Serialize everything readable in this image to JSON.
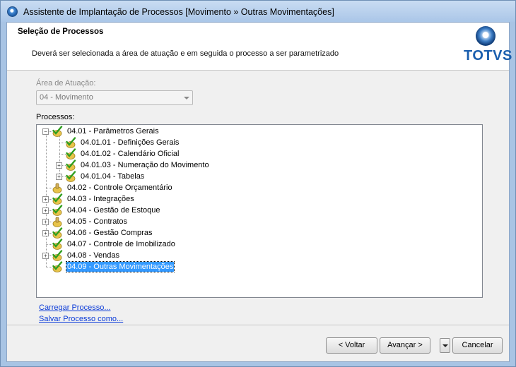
{
  "window": {
    "title": "Assistente de Implantação de Processos [Movimento » Outras Movimentações]"
  },
  "header": {
    "title": "Seleção de Processos",
    "description": "Deverá ser selecionada a área de atuação e em seguida o processo a ser parametrizado",
    "logo_text": "TOTVS"
  },
  "area": {
    "label": "Área de Atuação:",
    "value": "04 - Movimento"
  },
  "processes": {
    "label": "Processos:",
    "items": [
      {
        "label": "04.01 - Parâmetros Gerais",
        "level": 0,
        "expander": "minus",
        "icon": "check"
      },
      {
        "label": "04.01.01 - Definições Gerais",
        "level": 1,
        "expander": "none",
        "icon": "check"
      },
      {
        "label": "04.01.02 - Calendário Oficial",
        "level": 1,
        "expander": "none",
        "icon": "check"
      },
      {
        "label": "04.01.03 - Numeração do Movimento",
        "level": 1,
        "expander": "plus",
        "icon": "check"
      },
      {
        "label": "04.01.04 - Tabelas",
        "level": 1,
        "expander": "plus",
        "icon": "check"
      },
      {
        "label": "04.02 - Controle Orçamentário",
        "level": 0,
        "expander": "none",
        "icon": "thumb"
      },
      {
        "label": "04.03 - Integrações",
        "level": 0,
        "expander": "plus",
        "icon": "check"
      },
      {
        "label": "04.04 - Gestão de Estoque",
        "level": 0,
        "expander": "plus",
        "icon": "check"
      },
      {
        "label": "04.05 - Contratos",
        "level": 0,
        "expander": "plus",
        "icon": "thumb"
      },
      {
        "label": "04.06 - Gestão Compras",
        "level": 0,
        "expander": "plus",
        "icon": "check"
      },
      {
        "label": "04.07 - Controle de Imobilizado",
        "level": 0,
        "expander": "none",
        "icon": "check"
      },
      {
        "label": "04.08 - Vendas",
        "level": 0,
        "expander": "plus",
        "icon": "check"
      },
      {
        "label": "04.09 - Outras Movimentações",
        "level": 0,
        "expander": "none",
        "icon": "check",
        "selected": true
      }
    ]
  },
  "links": {
    "load": "Carregar Processo...",
    "save": "Salvar Processo como..."
  },
  "buttons": {
    "back": "< Voltar",
    "next": "Avançar >",
    "cancel": "Cancelar"
  },
  "colors": {
    "selection": "#3399ff",
    "link": "#0b3bd8",
    "logo": "#1b5fae",
    "check": "#2e9e1f",
    "node_yellow": "#e8c44a"
  }
}
